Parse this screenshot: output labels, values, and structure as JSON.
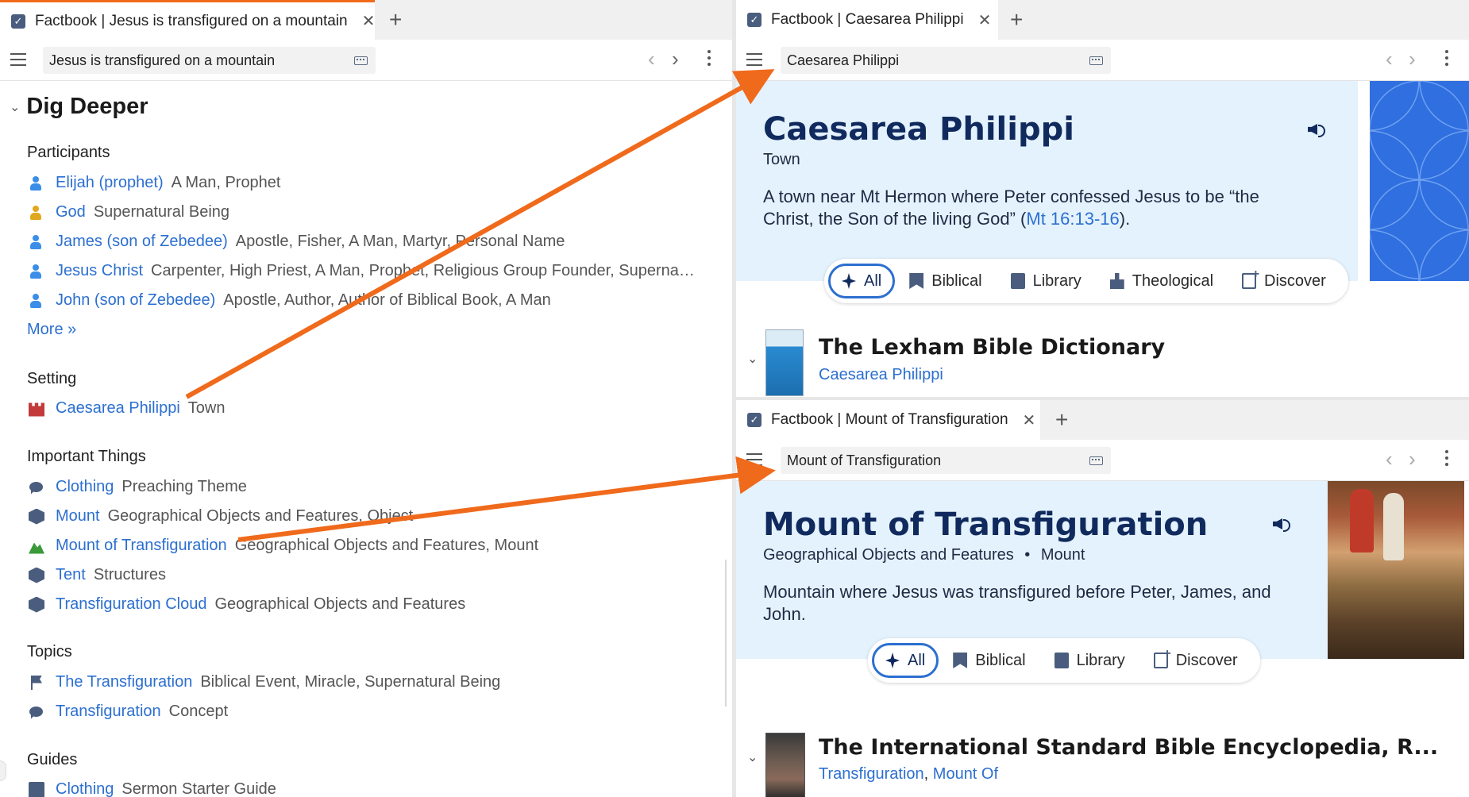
{
  "colors": {
    "accent_orange": "#f06a1c",
    "link_blue": "#2c6fd0",
    "hero_bg": "#e4f2fd",
    "title_navy": "#112a5e"
  },
  "left": {
    "tab": {
      "title": "Factbook | Jesus is transfigured on a mountain"
    },
    "address": "Jesus is transfigured on a mountain",
    "dig_deeper": "Dig Deeper",
    "participants": {
      "title": "Participants",
      "items": [
        {
          "link": "Elijah (prophet)",
          "desc": "A Man, Prophet",
          "icon": "person-icon"
        },
        {
          "link": "God",
          "desc": "Supernatural Being",
          "icon": "person-icon"
        },
        {
          "link": "James (son of Zebedee)",
          "desc": "Apostle, Fisher, A Man, Martyr, Personal Name",
          "icon": "person-icon"
        },
        {
          "link": "Jesus Christ",
          "desc": "Carpenter, High Priest, A Man, Prophet, Religious Group Founder, Superna…",
          "icon": "person-icon"
        },
        {
          "link": "John (son of Zebedee)",
          "desc": "Apostle, Author, Author of Biblical Book, A Man",
          "icon": "person-icon"
        }
      ],
      "more": "More »"
    },
    "setting": {
      "title": "Setting",
      "items": [
        {
          "link": "Caesarea Philippi",
          "desc": "Town",
          "icon": "castle-icon"
        }
      ]
    },
    "important_things": {
      "title": "Important Things",
      "items": [
        {
          "link": "Clothing",
          "desc": "Preaching Theme",
          "icon": "speech-bubble-icon"
        },
        {
          "link": "Mount",
          "desc": "Geographical Objects and Features, Object",
          "icon": "cube-icon"
        },
        {
          "link": "Mount of Transfiguration",
          "desc": "Geographical Objects and Features, Mount",
          "icon": "mountain-icon"
        },
        {
          "link": "Tent",
          "desc": "Structures",
          "icon": "cube-icon"
        },
        {
          "link": "Transfiguration Cloud",
          "desc": "Geographical Objects and Features",
          "icon": "cube-icon"
        }
      ]
    },
    "topics": {
      "title": "Topics",
      "items": [
        {
          "link": "The Transfiguration",
          "desc": "Biblical Event, Miracle, Supernatural Being",
          "icon": "flag-icon"
        },
        {
          "link": "Transfiguration",
          "desc": "Concept",
          "icon": "speech-bubble-icon"
        }
      ]
    },
    "guides": {
      "title": "Guides",
      "items": [
        {
          "link": "Clothing",
          "desc": "Sermon Starter Guide",
          "icon": "guide-book-icon"
        }
      ]
    }
  },
  "top_right": {
    "tab": {
      "title": "Factbook | Caesarea Philippi"
    },
    "address": "Caesarea Philippi",
    "hero": {
      "title": "Caesarea Philippi",
      "type": "Town",
      "desc_before": "A town near Mt Hermon where Peter confessed Jesus to be “the Christ, the Son of the living God” (",
      "desc_link": "Mt 16:13-16",
      "desc_after": ")."
    },
    "filters": [
      "All",
      "Biblical",
      "Library",
      "Theological",
      "Discover"
    ],
    "result": {
      "title": "The Lexham Bible Dictionary",
      "subtitle": "Caesarea Philippi"
    }
  },
  "bottom_right": {
    "tab": {
      "title": "Factbook | Mount of Transfiguration"
    },
    "address": "Mount of Transfiguration",
    "hero": {
      "title": "Mount of Transfiguration",
      "type_a": "Geographical Objects and Features",
      "type_sep": "•",
      "type_b": "Mount",
      "desc": "Mountain where Jesus was transfigured before Peter, James, and John."
    },
    "filters": [
      "All",
      "Biblical",
      "Library",
      "Discover"
    ],
    "result": {
      "title": "The International Standard Bible Encyclopedia, R...",
      "subtitle_a": "Transfiguration",
      "subtitle_sep": ", ",
      "subtitle_b": "Mount Of"
    }
  }
}
